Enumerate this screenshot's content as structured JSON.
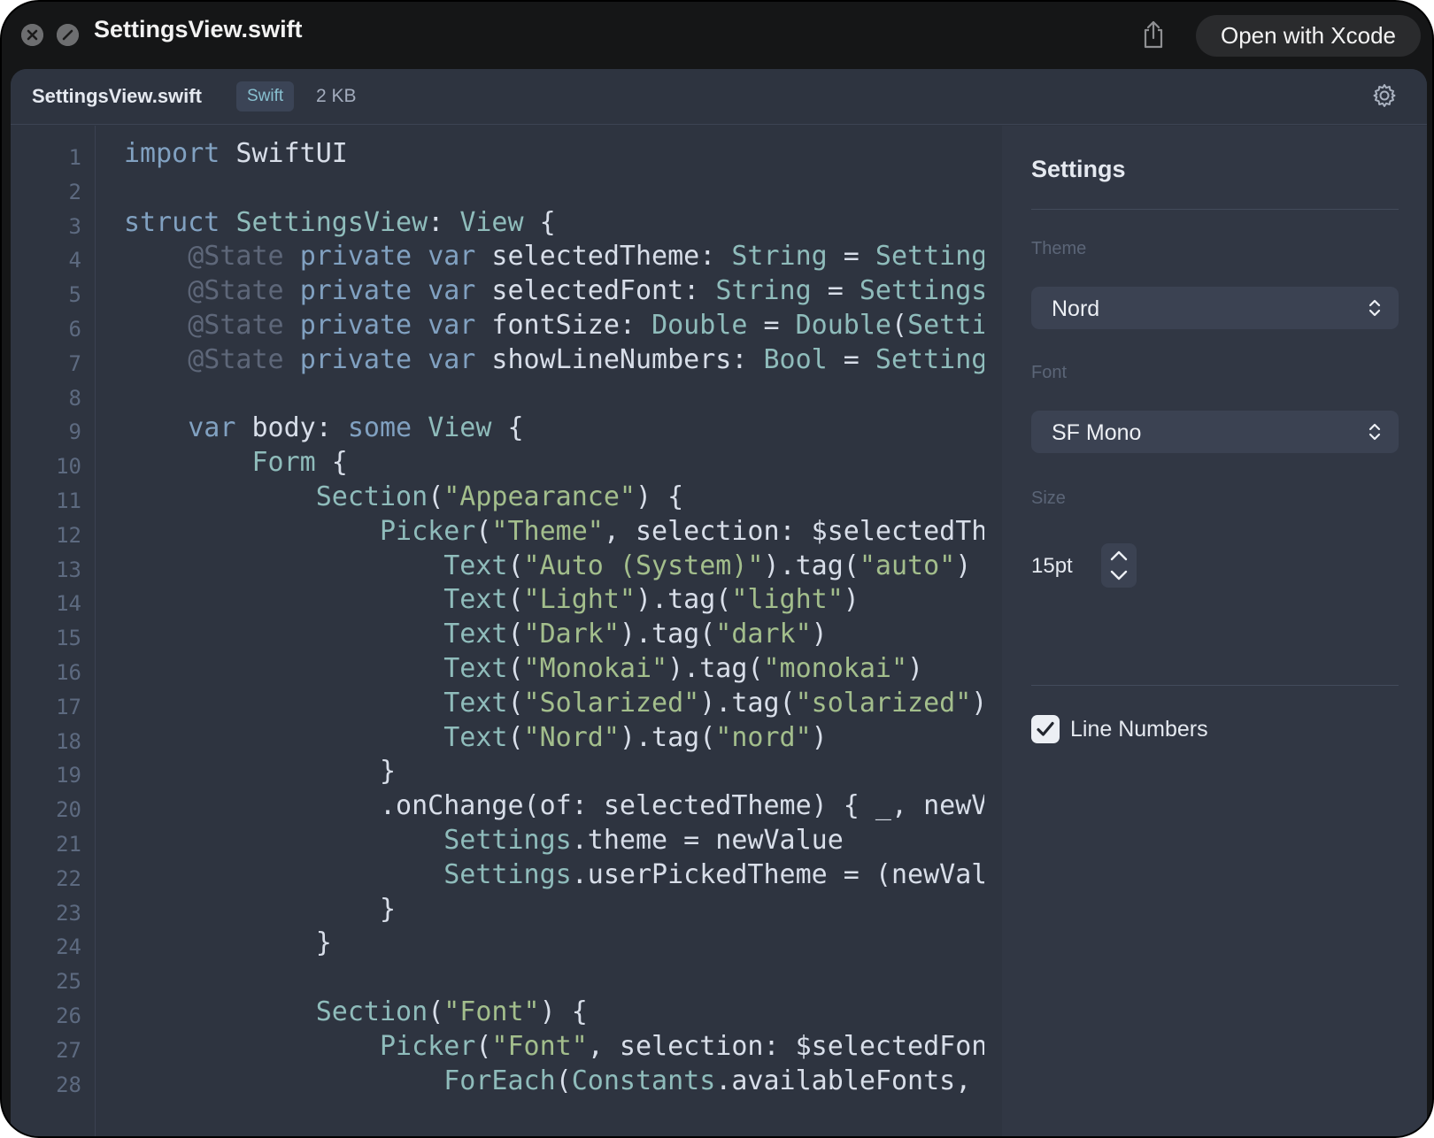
{
  "window": {
    "title": "SettingsView.swift",
    "open_button_label": "Open with Xcode"
  },
  "file": {
    "name": "SettingsView.swift",
    "language": "Swift",
    "size": "2 KB"
  },
  "code": {
    "line_numbers": [
      "1",
      "2",
      "3",
      "4",
      "5",
      "6",
      "7",
      "8",
      "9",
      "10",
      "11",
      "12",
      "13",
      "14",
      "15",
      "16",
      "17",
      "18",
      "19",
      "20",
      "21",
      "22",
      "23",
      "24",
      "25",
      "26",
      "27",
      "28"
    ],
    "lines": [
      [
        [
          "kw",
          "import"
        ],
        [
          "pl",
          " SwiftUI"
        ]
      ],
      [],
      [
        [
          "kw",
          "struct"
        ],
        [
          "pl",
          " "
        ],
        [
          "ty",
          "SettingsView"
        ],
        [
          "pl",
          ": "
        ],
        [
          "ty",
          "View"
        ],
        [
          "pl",
          " {"
        ]
      ],
      [
        [
          "pl",
          "    "
        ],
        [
          "at",
          "@State"
        ],
        [
          "pl",
          " "
        ],
        [
          "kw",
          "private"
        ],
        [
          "pl",
          " "
        ],
        [
          "kw",
          "var"
        ],
        [
          "pl",
          " selectedTheme: "
        ],
        [
          "ty",
          "String"
        ],
        [
          "pl",
          " = "
        ],
        [
          "ty",
          "Setting"
        ]
      ],
      [
        [
          "pl",
          "    "
        ],
        [
          "at",
          "@State"
        ],
        [
          "pl",
          " "
        ],
        [
          "kw",
          "private"
        ],
        [
          "pl",
          " "
        ],
        [
          "kw",
          "var"
        ],
        [
          "pl",
          " selectedFont: "
        ],
        [
          "ty",
          "String"
        ],
        [
          "pl",
          " = "
        ],
        [
          "ty",
          "Settings"
        ]
      ],
      [
        [
          "pl",
          "    "
        ],
        [
          "at",
          "@State"
        ],
        [
          "pl",
          " "
        ],
        [
          "kw",
          "private"
        ],
        [
          "pl",
          " "
        ],
        [
          "kw",
          "var"
        ],
        [
          "pl",
          " fontSize: "
        ],
        [
          "ty",
          "Double"
        ],
        [
          "pl",
          " = "
        ],
        [
          "ty",
          "Double"
        ],
        [
          "pl",
          "("
        ],
        [
          "ty",
          "Setti"
        ]
      ],
      [
        [
          "pl",
          "    "
        ],
        [
          "at",
          "@State"
        ],
        [
          "pl",
          " "
        ],
        [
          "kw",
          "private"
        ],
        [
          "pl",
          " "
        ],
        [
          "kw",
          "var"
        ],
        [
          "pl",
          " showLineNumbers: "
        ],
        [
          "ty",
          "Bool"
        ],
        [
          "pl",
          " = "
        ],
        [
          "ty",
          "Setting"
        ]
      ],
      [],
      [
        [
          "pl",
          "    "
        ],
        [
          "kw",
          "var"
        ],
        [
          "pl",
          " body: "
        ],
        [
          "kw",
          "some"
        ],
        [
          "pl",
          " "
        ],
        [
          "ty",
          "View"
        ],
        [
          "pl",
          " {"
        ]
      ],
      [
        [
          "pl",
          "        "
        ],
        [
          "ty",
          "Form"
        ],
        [
          "pl",
          " {"
        ]
      ],
      [
        [
          "pl",
          "            "
        ],
        [
          "ty",
          "Section"
        ],
        [
          "pl",
          "("
        ],
        [
          "st",
          "\"Appearance\""
        ],
        [
          "pl",
          ") {"
        ]
      ],
      [
        [
          "pl",
          "                "
        ],
        [
          "ty",
          "Picker"
        ],
        [
          "pl",
          "("
        ],
        [
          "st",
          "\"Theme\""
        ],
        [
          "pl",
          ", selection: $selectedTh"
        ]
      ],
      [
        [
          "pl",
          "                    "
        ],
        [
          "ty",
          "Text"
        ],
        [
          "pl",
          "("
        ],
        [
          "st",
          "\"Auto (System)\""
        ],
        [
          "pl",
          ").tag("
        ],
        [
          "st",
          "\"auto\""
        ],
        [
          "pl",
          ")"
        ]
      ],
      [
        [
          "pl",
          "                    "
        ],
        [
          "ty",
          "Text"
        ],
        [
          "pl",
          "("
        ],
        [
          "st",
          "\"Light\""
        ],
        [
          "pl",
          ").tag("
        ],
        [
          "st",
          "\"light\""
        ],
        [
          "pl",
          ")"
        ]
      ],
      [
        [
          "pl",
          "                    "
        ],
        [
          "ty",
          "Text"
        ],
        [
          "pl",
          "("
        ],
        [
          "st",
          "\"Dark\""
        ],
        [
          "pl",
          ").tag("
        ],
        [
          "st",
          "\"dark\""
        ],
        [
          "pl",
          ")"
        ]
      ],
      [
        [
          "pl",
          "                    "
        ],
        [
          "ty",
          "Text"
        ],
        [
          "pl",
          "("
        ],
        [
          "st",
          "\"Monokai\""
        ],
        [
          "pl",
          ").tag("
        ],
        [
          "st",
          "\"monokai\""
        ],
        [
          "pl",
          ")"
        ]
      ],
      [
        [
          "pl",
          "                    "
        ],
        [
          "ty",
          "Text"
        ],
        [
          "pl",
          "("
        ],
        [
          "st",
          "\"Solarized\""
        ],
        [
          "pl",
          ").tag("
        ],
        [
          "st",
          "\"solarized\""
        ],
        [
          "pl",
          ")"
        ]
      ],
      [
        [
          "pl",
          "                    "
        ],
        [
          "ty",
          "Text"
        ],
        [
          "pl",
          "("
        ],
        [
          "st",
          "\"Nord\""
        ],
        [
          "pl",
          ").tag("
        ],
        [
          "st",
          "\"nord\""
        ],
        [
          "pl",
          ")"
        ]
      ],
      [
        [
          "pl",
          "                }"
        ]
      ],
      [
        [
          "pl",
          "                .onChange(of: selectedTheme) { _, newV"
        ]
      ],
      [
        [
          "pl",
          "                    "
        ],
        [
          "ty",
          "Settings"
        ],
        [
          "pl",
          ".theme = newValue"
        ]
      ],
      [
        [
          "pl",
          "                    "
        ],
        [
          "ty",
          "Settings"
        ],
        [
          "pl",
          ".userPickedTheme = (newVal"
        ]
      ],
      [
        [
          "pl",
          "                }"
        ]
      ],
      [
        [
          "pl",
          "            }"
        ]
      ],
      [],
      [
        [
          "pl",
          "            "
        ],
        [
          "ty",
          "Section"
        ],
        [
          "pl",
          "("
        ],
        [
          "st",
          "\"Font\""
        ],
        [
          "pl",
          ") {"
        ]
      ],
      [
        [
          "pl",
          "                "
        ],
        [
          "ty",
          "Picker"
        ],
        [
          "pl",
          "("
        ],
        [
          "st",
          "\"Font\""
        ],
        [
          "pl",
          ", selection: $selectedFon"
        ]
      ],
      [
        [
          "pl",
          "                    "
        ],
        [
          "ty",
          "ForEach"
        ],
        [
          "pl",
          "("
        ],
        [
          "ty",
          "Constants"
        ],
        [
          "pl",
          ".availableFonts,"
        ]
      ]
    ]
  },
  "settings": {
    "title": "Settings",
    "theme_label": "Theme",
    "theme_value": "Nord",
    "font_label": "Font",
    "font_value": "SF Mono",
    "size_label": "Size",
    "size_value": "15pt",
    "line_numbers_label": "Line Numbers",
    "line_numbers_checked": true
  },
  "colors": {
    "keyword": "#81a1c1",
    "type": "#8fbcbb",
    "string": "#a3be8c",
    "attribute": "#5e6779",
    "plain": "#d8dee9",
    "background": "#2e3440"
  },
  "icons": [
    "close-icon",
    "slash-icon",
    "share-icon",
    "gear-icon",
    "chevron-updown-icon",
    "chevron-up-icon",
    "chevron-down-icon",
    "checkmark-icon"
  ]
}
